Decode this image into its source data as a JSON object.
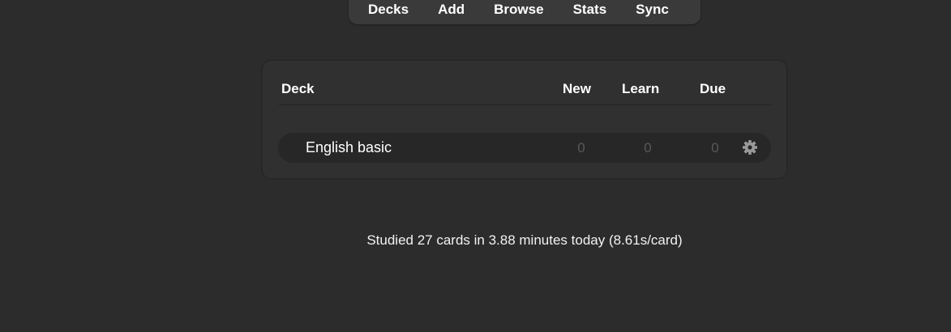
{
  "toolbar": {
    "items": [
      {
        "label": "Decks"
      },
      {
        "label": "Add"
      },
      {
        "label": "Browse"
      },
      {
        "label": "Stats"
      },
      {
        "label": "Sync"
      }
    ]
  },
  "deck_table": {
    "headers": {
      "deck": "Deck",
      "new": "New",
      "learn": "Learn",
      "due": "Due"
    },
    "rows": [
      {
        "name": "English basic",
        "new": "0",
        "learn": "0",
        "due": "0",
        "options_icon": "gear-icon"
      }
    ]
  },
  "study_stats": {
    "text": "Studied 27 cards in 3.88 minutes today (8.61s/card)"
  },
  "colors": {
    "background": "#2c2c2c",
    "card": "#303030",
    "row": "#272727",
    "toolbar": "#3a3a3a",
    "muted_count": "#585858",
    "text": "#ffffff"
  }
}
